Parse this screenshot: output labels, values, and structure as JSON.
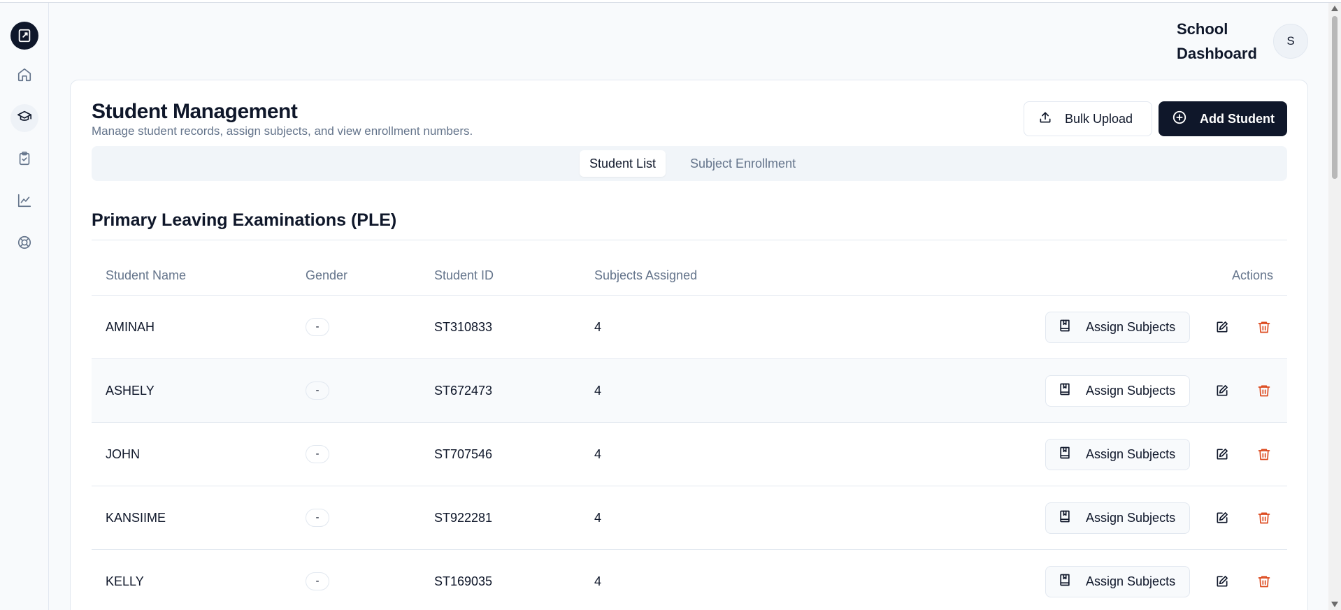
{
  "header": {
    "title": "School Dashboard",
    "avatar_initial": "S"
  },
  "sidebar": {
    "logo_icon": "book-logo-icon",
    "items": [
      {
        "icon": "home-icon",
        "active": false
      },
      {
        "icon": "graduation-cap-icon",
        "active": true
      },
      {
        "icon": "clipboard-check-icon",
        "active": false
      },
      {
        "icon": "line-chart-icon",
        "active": false
      },
      {
        "icon": "lifebuoy-icon",
        "active": false
      }
    ]
  },
  "page": {
    "title": "Student Management",
    "subtitle": "Manage student records, assign subjects, and view enrollment numbers.",
    "bulk_upload_label": "Bulk Upload",
    "add_student_label": "Add Student"
  },
  "tabs": [
    {
      "label": "Student List",
      "active": true
    },
    {
      "label": "Subject Enrollment",
      "active": false
    }
  ],
  "section": {
    "title": "Primary Leaving Examinations (PLE)"
  },
  "table": {
    "columns": [
      "Student Name",
      "Gender",
      "Student ID",
      "Subjects Assigned",
      "Actions"
    ],
    "assign_label": "Assign Subjects",
    "rows": [
      {
        "name": "AMINAH",
        "gender": "-",
        "id": "ST310833",
        "subjects": "4"
      },
      {
        "name": "ASHELY",
        "gender": "-",
        "id": "ST672473",
        "subjects": "4"
      },
      {
        "name": "JOHN",
        "gender": "-",
        "id": "ST707546",
        "subjects": "4"
      },
      {
        "name": "KANSIIME",
        "gender": "-",
        "id": "ST922281",
        "subjects": "4"
      },
      {
        "name": "KELLY",
        "gender": "-",
        "id": "ST169035",
        "subjects": "4"
      }
    ]
  },
  "colors": {
    "primary": "#0f172a",
    "muted": "#64748b",
    "danger": "#dc4a1e",
    "border": "#e2e8f0"
  }
}
